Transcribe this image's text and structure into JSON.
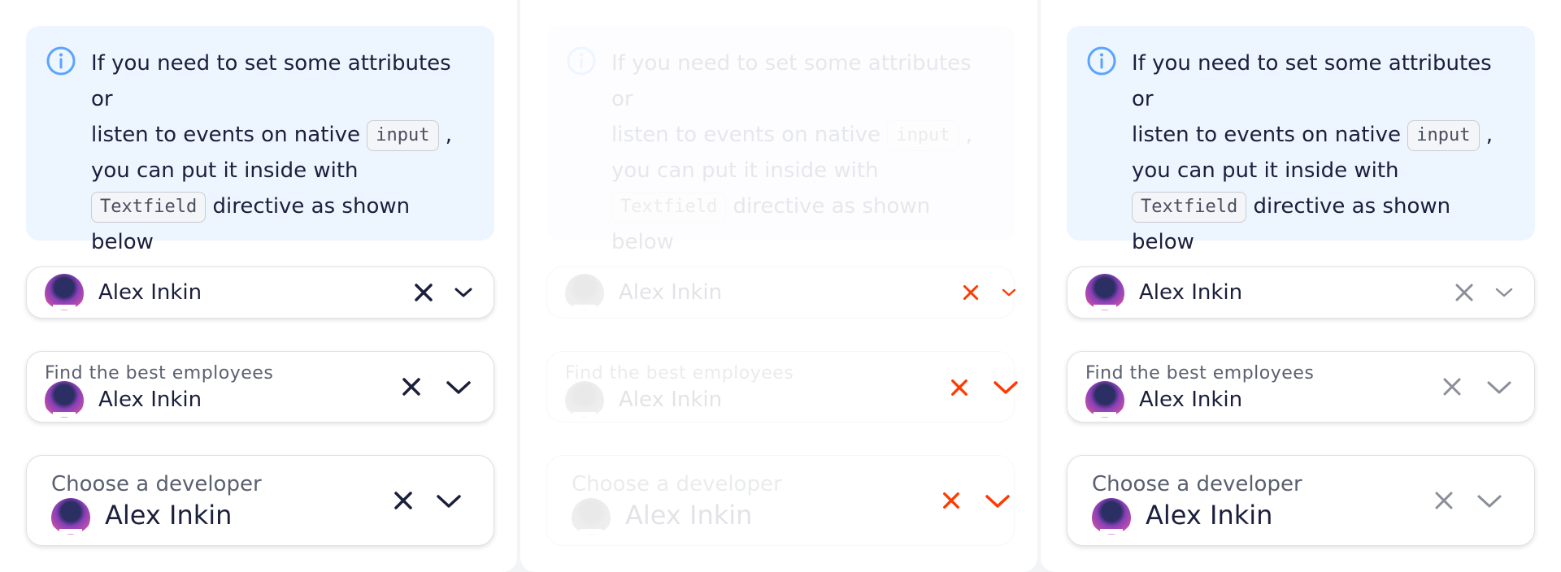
{
  "notice": {
    "line1": "If you need to set some attributes or",
    "line2_prefix": "listen to events on native",
    "code_input": "input",
    "line2_suffix": ",",
    "line3": "you can put it inside with",
    "code_textfield": "Textfield",
    "line4_suffix": "directive as shown",
    "line5": "below"
  },
  "fields": {
    "simple": {
      "value": "Alex Inkin"
    },
    "labeled": {
      "label": "Find the best employees",
      "value": "Alex Inkin"
    },
    "large": {
      "label": "Choose a developer",
      "value": "Alex Inkin"
    }
  },
  "icons": {
    "info": "info-icon",
    "clear": "close-icon",
    "dropdown": "chevron-down-icon"
  },
  "colors": {
    "notice_bg": "#edf5ff",
    "info_icon": "#5aa4ff",
    "icon_default": "#1b1f3b",
    "icon_muted": "#8b8f99",
    "icon_accent": "#ff3a00"
  }
}
